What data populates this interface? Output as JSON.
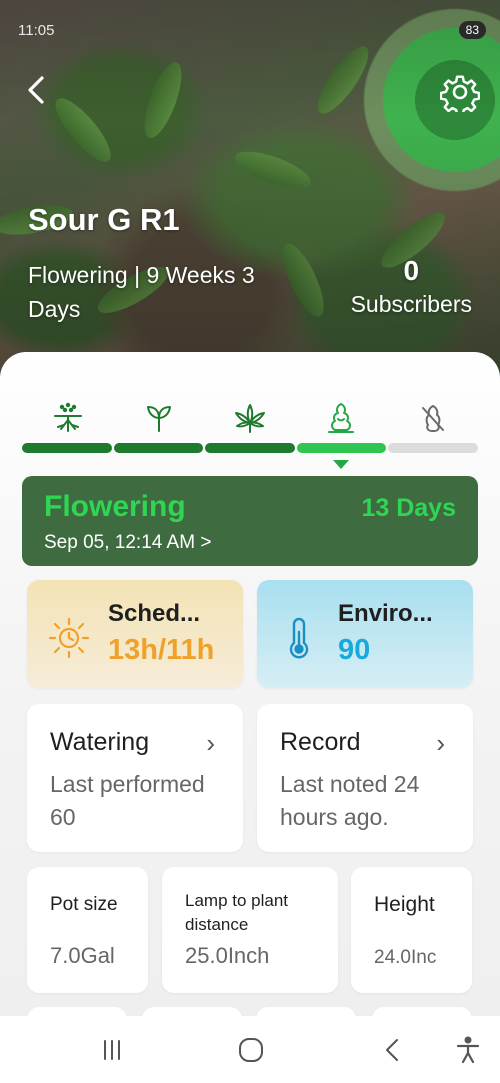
{
  "status_bar": {
    "time": "11:05",
    "battery": "83"
  },
  "header": {
    "plant_name": "Sour G R1",
    "stage_summary": "Flowering | 9 Weeks 3 Days",
    "subscribers_count": "0",
    "subscribers_label": "Subscribers"
  },
  "stages": {
    "icons": [
      "germination-icon",
      "seedling-icon",
      "vegetative-icon",
      "flowering-icon",
      "harvest-icon"
    ],
    "progress_segments": [
      "done",
      "done",
      "done",
      "current",
      "future"
    ]
  },
  "current_stage": {
    "name": "Flowering",
    "days": "13 Days",
    "start": "Sep 05, 12:14 AM >"
  },
  "schedule": {
    "title": "Sched...",
    "value": "13h/11h"
  },
  "environment": {
    "title": "Enviro...",
    "value": "90"
  },
  "watering": {
    "title": "Watering",
    "description": "Last performed 60",
    "chevron": "›"
  },
  "record": {
    "title": "Record",
    "description": "Last noted 24 hours ago.",
    "chevron": "›"
  },
  "metrics": {
    "pot": {
      "label": "Pot size",
      "value": "7.0Gal"
    },
    "lamp": {
      "label": "Lamp to plant distance",
      "value": "25.0Inch"
    },
    "height": {
      "label": "Height",
      "value": "24.0Inc"
    }
  },
  "colors": {
    "accent_green": "#2fd653",
    "stage_card_bg": "#3f6b40",
    "schedule_accent": "#f0a12a",
    "environment_accent": "#1aa9dd"
  }
}
